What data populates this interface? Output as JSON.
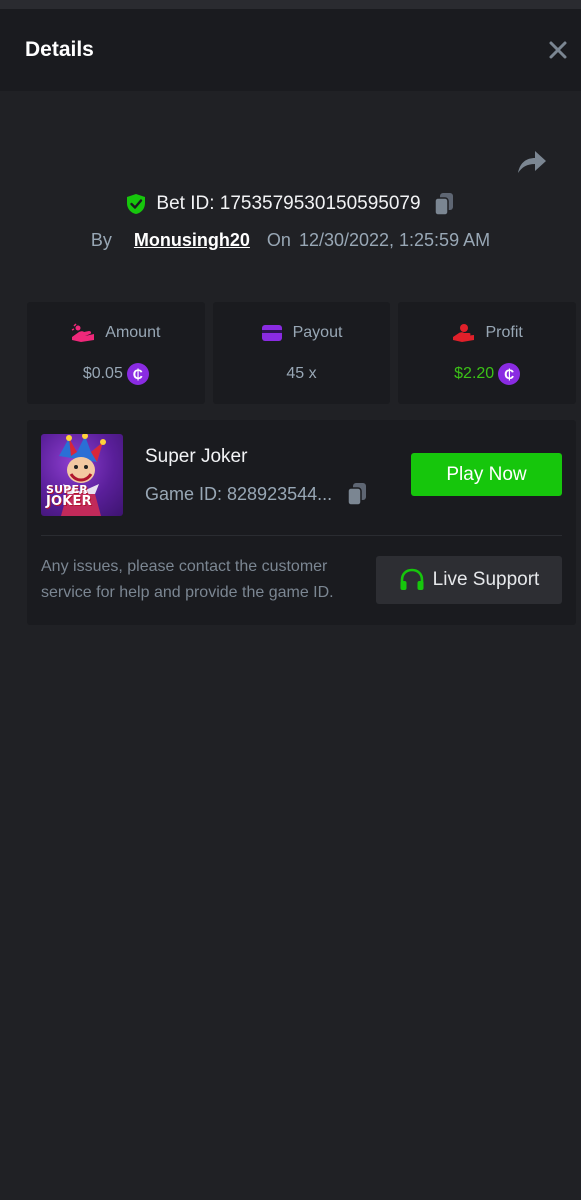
{
  "header": {
    "title": "Details",
    "close_icon": "close-icon"
  },
  "share_icon": "share-icon",
  "bet": {
    "id_label": "Bet ID: 1753579530150595079",
    "by_label": "By",
    "user": "Monusingh20",
    "on_label": "On",
    "datetime": "12/30/2022, 1:25:59 AM"
  },
  "stats": {
    "amount": {
      "label": "Amount",
      "value": "$0.05",
      "icon": "hand-coin-icon",
      "icon_color": "#f0287a"
    },
    "payout": {
      "label": "Payout",
      "value": "45 x",
      "icon": "card-icon",
      "icon_color": "#8a2be2"
    },
    "profit": {
      "label": "Profit",
      "value": "$2.20",
      "icon": "hand-profit-icon",
      "icon_color": "#e0202a"
    }
  },
  "currency_symbol": "₵",
  "game": {
    "name": "Super Joker",
    "id_label": "Game ID: 828923544...",
    "thumb_line1": "SUPER",
    "thumb_line2": "JOKER",
    "play_label": "Play Now"
  },
  "support": {
    "text": "Any issues, please contact the customer service for help and provide the game ID.",
    "button_label": "Live Support",
    "icon": "headset-icon"
  },
  "colors": {
    "background": "#202125",
    "panel": "#1a1b1f",
    "accent_green": "#16c60c",
    "profit_green": "#3bc117",
    "coin_purple": "#8a2be2",
    "muted_text": "#98a7b5"
  }
}
